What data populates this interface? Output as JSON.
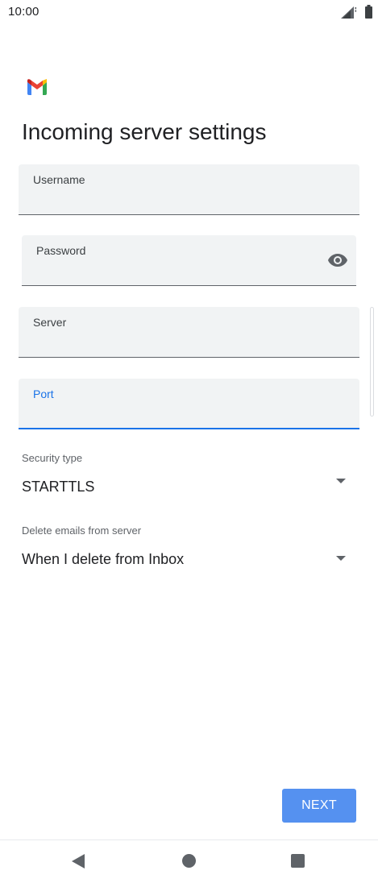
{
  "status_bar": {
    "time": "10:00",
    "signal_icon": "signal-icon",
    "battery_icon": "battery-icon"
  },
  "app": {
    "logo_icon": "gmail-logo-icon"
  },
  "page": {
    "title": "Incoming server settings"
  },
  "fields": {
    "username": {
      "label": "Username",
      "value": ""
    },
    "password": {
      "label": "Password",
      "value": "",
      "toggle_icon": "eye-icon"
    },
    "server": {
      "label": "Server",
      "value": ""
    },
    "port": {
      "label": "Port",
      "value": "",
      "focused": true
    }
  },
  "security_type": {
    "label": "Security type",
    "value": "STARTTLS"
  },
  "delete_emails": {
    "label": "Delete emails from server",
    "value": "When I delete from Inbox"
  },
  "actions": {
    "next_label": "NEXT"
  },
  "nav_bar": {
    "back_icon": "back-icon",
    "home_icon": "home-icon",
    "recents_icon": "recents-icon"
  },
  "colors": {
    "accent": "#1a73e8",
    "button": "#5591f0",
    "field_bg": "#f1f3f4",
    "text": "#202124",
    "secondary_text": "#5f6368"
  }
}
